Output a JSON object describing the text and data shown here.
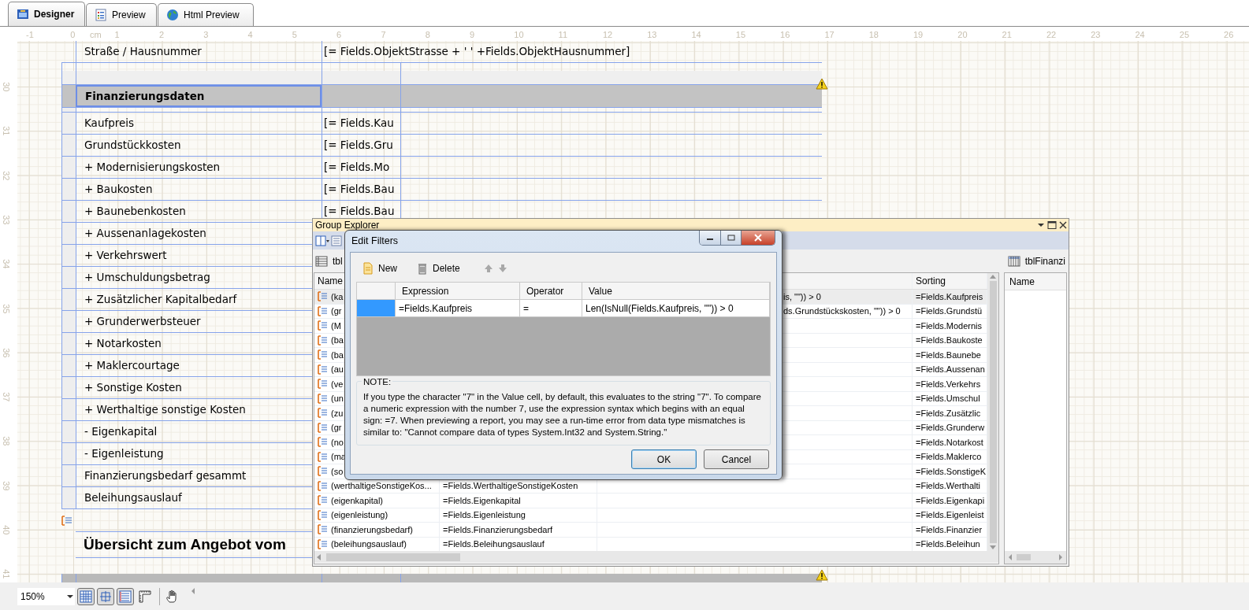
{
  "tabs": [
    {
      "label": "Designer",
      "selected": true,
      "kind": "designer"
    },
    {
      "label": "Preview",
      "selected": false,
      "kind": "preview"
    },
    {
      "label": "Html Preview",
      "selected": false,
      "kind": "html"
    }
  ],
  "ruler": {
    "unit": "cm",
    "horizontal": [
      "-1",
      "0",
      "1",
      "2",
      "3",
      "4",
      "5",
      "6",
      "7",
      "8",
      "9",
      "10",
      "11",
      "12",
      "13",
      "14",
      "15",
      "16",
      "17",
      "18",
      "19",
      "20",
      "21",
      "22",
      "23",
      "24",
      "25",
      "26"
    ],
    "vertical": [
      "30",
      "31",
      "32",
      "33",
      "34",
      "35",
      "36",
      "37",
      "38",
      "39",
      "40",
      "41"
    ]
  },
  "report": {
    "rows": [
      {
        "kind": "plain",
        "label": "Straße / Hausnummer",
        "value": "[= Fields.ObjektStrasse + ' ' +Fields.ObjektHausnummer]"
      },
      {
        "kind": "strip"
      },
      {
        "kind": "band"
      },
      {
        "kind": "header",
        "label": "Finanzierungsdaten",
        "selected": true
      },
      {
        "kind": "gap"
      },
      {
        "kind": "row",
        "label": "Kaufpreis",
        "value": "[= Fields.Kau"
      },
      {
        "kind": "row",
        "label": "Grundstückkosten",
        "value": "[= Fields.Gru"
      },
      {
        "kind": "row",
        "label": "+ Modernisierungskosten",
        "value": "[= Fields.Mo"
      },
      {
        "kind": "row",
        "label": "+ Baukosten",
        "value": "[= Fields.Bau"
      },
      {
        "kind": "row",
        "label": "+ Baunebenkosten",
        "value": "[= Fields.Bau"
      },
      {
        "kind": "row",
        "label": "+ Aussenanlagekosten"
      },
      {
        "kind": "row",
        "label": "+ Verkehrswert"
      },
      {
        "kind": "row",
        "label": "+ Umschuldungsbetrag"
      },
      {
        "kind": "row",
        "label": "+ Zusätzlicher Kapitalbedarf"
      },
      {
        "kind": "row",
        "label": "+ Grunderwerbsteuer"
      },
      {
        "kind": "row",
        "label": "+ Notarkosten"
      },
      {
        "kind": "row",
        "label": "+ Maklercourtage"
      },
      {
        "kind": "row",
        "label": "+ Sonstige Kosten"
      },
      {
        "kind": "row",
        "label": "+ Werthaltige sonstige Kosten"
      },
      {
        "kind": "row",
        "label": "- Eigenkapital"
      },
      {
        "kind": "row",
        "label": "- Eigenleistung"
      },
      {
        "kind": "row",
        "label": "Finanzierungsbedarf gesammt"
      },
      {
        "kind": "row",
        "label": "Beleihungsauslauf"
      }
    ],
    "title": "Übersicht zum Angebot vom"
  },
  "group_explorer": {
    "title": "Group Explorer",
    "group_label": "tbl",
    "table_label": "tblFinanzi",
    "columns": {
      "name": "Name",
      "sorting": "Sorting"
    },
    "side_column": "Name",
    "rows": [
      {
        "name": "(ka",
        "filter": "is, \"\")) > 0",
        "sorting": "=Fields.Kaufpreis",
        "selected": true
      },
      {
        "name": "(gr",
        "filter": "ds.Grundstückskosten, \"\")) > 0",
        "sorting": "=Fields.Grundstü",
        "selected": false
      },
      {
        "name": "(M",
        "sorting": "=Fields.Modernis",
        "selected": false
      },
      {
        "name": "(ba",
        "sorting": "=Fields.Baukoste",
        "selected": false
      },
      {
        "name": "(ba",
        "sorting": "=Fields.Baunebe",
        "selected": false
      },
      {
        "name": "(au",
        "sorting": "=Fields.Aussenan",
        "selected": false
      },
      {
        "name": "(ve",
        "sorting": "=Fields.Verkehrs",
        "selected": false
      },
      {
        "name": "(un",
        "sorting": "=Fields.Umschul",
        "selected": false
      },
      {
        "name": "(zu",
        "sorting": "=Fields.Zusätzlic",
        "selected": false
      },
      {
        "name": "(gr",
        "sorting": "=Fields.Grunderw",
        "selected": false
      },
      {
        "name": "(no",
        "sorting": "=Fields.Notarkost",
        "selected": false
      },
      {
        "name": "(ma",
        "sorting": "=Fields.Maklerco",
        "selected": false
      },
      {
        "name": "(so",
        "sorting": "=Fields.SonstigeK",
        "selected": false
      },
      {
        "name": "(werthaltigeSonstigeKos...",
        "expression": "=Fields.WerthaltigeSonstigeKosten",
        "sorting": "=Fields.Werthalti",
        "selected": false
      },
      {
        "name": "(eigenkapital)",
        "expression": "=Fields.Eigenkapital",
        "sorting": "=Fields.Eigenkapi",
        "selected": false
      },
      {
        "name": "(eigenleistung)",
        "expression": "=Fields.Eigenleistung",
        "sorting": "=Fields.Eigenleist",
        "selected": false
      },
      {
        "name": "(finanzierungsbedarf)",
        "expression": "=Fields.Finanzierungsbedarf",
        "sorting": "=Fields.Finanzier",
        "selected": false
      },
      {
        "name": "(beleihungsauslauf)",
        "expression": "=Fields.Beleihungsauslauf",
        "sorting": "=Fields.Beleihun",
        "selected": false
      }
    ]
  },
  "dialog": {
    "title": "Edit Filters",
    "toolbar": [
      {
        "kind": "new",
        "label": "New"
      },
      {
        "kind": "delete",
        "label": "Delete"
      }
    ],
    "columns": [
      "Expression",
      "Operator",
      "Value"
    ],
    "filters": [
      {
        "expression": "=Fields.Kaufpreis",
        "operator": "=",
        "value": "Len(IsNull(Fields.Kaufpreis, \"\")) > 0",
        "selected": true
      }
    ],
    "note_title": "NOTE:",
    "note": "If you type the character \"7\" in the Value cell, by default, this evaluates to the string \"7\". To compare a numeric expression with the number 7, use the expression syntax which begins with an equal sign: =7. When previewing a report, you may see a run-time error from data type mismatches is similar to: \"Cannot compare data of types System.Int32 and System.String.\"",
    "buttons": [
      {
        "label": "OK",
        "default": true
      },
      {
        "label": "Cancel",
        "default": false
      }
    ]
  },
  "status_bar": {
    "zoom": "150%",
    "toggles": [
      {
        "kind": "grid",
        "on": true
      },
      {
        "kind": "snap",
        "on": true
      },
      {
        "kind": "sections",
        "on": true
      },
      {
        "kind": "ruler",
        "on": false
      }
    ]
  }
}
